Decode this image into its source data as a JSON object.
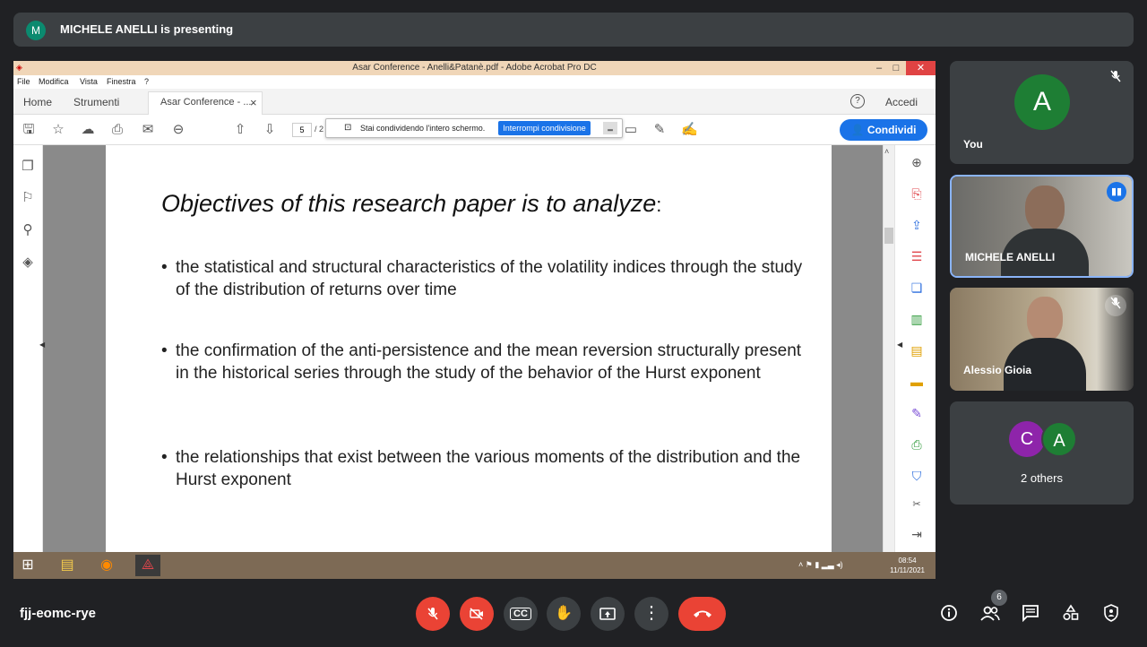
{
  "banner": {
    "avatar_letter": "M",
    "text": "MICHELE ANELLI is presenting"
  },
  "acrobat": {
    "window_title": "Asar Conference - Anelli&Patanè.pdf - Adobe Acrobat Pro DC",
    "window_buttons": [
      "–",
      "□",
      "✕"
    ],
    "menu": [
      "File",
      "Modifica",
      "Vista",
      "Finestra",
      "?"
    ],
    "tabs": {
      "home": "Home",
      "tools": "Strumenti",
      "doc": "Asar Conference - ...",
      "close": "×"
    },
    "help": "?",
    "sign_in": "Accedi",
    "page_current": "5",
    "page_sep": "/ 2",
    "share_notice": "Stai condividendo l'intero schermo.",
    "stop_sharing": "Interrompi condivisione",
    "share_button": "Condividi"
  },
  "slide": {
    "heading": "Objectives of this research paper is to analyze",
    "heading_colon": ":",
    "bullets": [
      "the statistical and structural characteristics of the volatility indices through the study of the distribution of returns over time",
      "the confirmation of the anti-persistence and the mean reversion structurally present in the historical series through the study of the behavior of the Hurst exponent",
      "the relationships that exist between the various moments of the distribution and the Hurst exponent"
    ]
  },
  "taskbar": {
    "time": "08:54",
    "date": "11/11/2021"
  },
  "participants": {
    "you": {
      "letter": "A",
      "name": "You",
      "color": "#1e7e34"
    },
    "presenter": {
      "name": "MICHELE ANELLI"
    },
    "third": {
      "name": "Alessio Gioia"
    },
    "others": {
      "letters": [
        "C",
        "A"
      ],
      "colors": [
        "#8e24aa",
        "#1e7e34"
      ],
      "label": "2 others"
    }
  },
  "bottom": {
    "meeting_code": "fjj-eomc-rye",
    "people_count": "6"
  },
  "colors": {
    "bg": "#202124",
    "tile": "#3c4043",
    "red": "#ea4335",
    "blue": "#1a73e8"
  }
}
